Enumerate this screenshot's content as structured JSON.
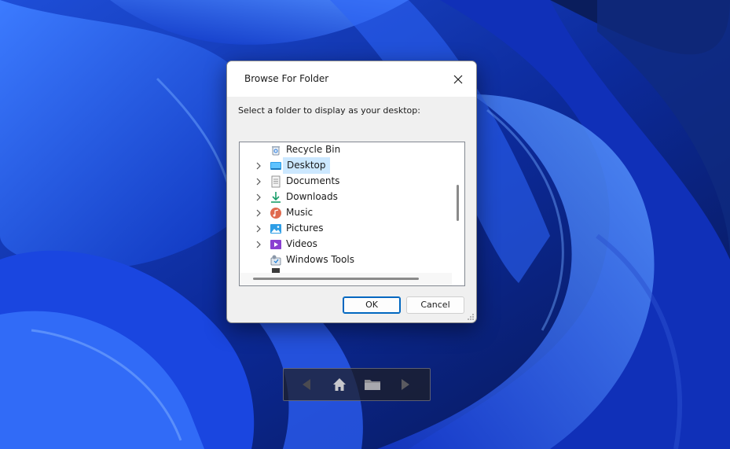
{
  "dialog": {
    "title": "Browse For Folder",
    "prompt": "Select a folder to display as your desktop:",
    "ok_label": "OK",
    "cancel_label": "Cancel"
  },
  "tree": {
    "items": [
      {
        "label": "Recycle Bin",
        "icon": "recycle-bin-icon",
        "expandable": false,
        "selected": false
      },
      {
        "label": "Desktop",
        "icon": "desktop-folder-icon",
        "expandable": true,
        "selected": true
      },
      {
        "label": "Documents",
        "icon": "documents-folder-icon",
        "expandable": true,
        "selected": false
      },
      {
        "label": "Downloads",
        "icon": "downloads-folder-icon",
        "expandable": true,
        "selected": false
      },
      {
        "label": "Music",
        "icon": "music-folder-icon",
        "expandable": true,
        "selected": false
      },
      {
        "label": "Pictures",
        "icon": "pictures-folder-icon",
        "expandable": true,
        "selected": false
      },
      {
        "label": "Videos",
        "icon": "videos-folder-icon",
        "expandable": true,
        "selected": false
      },
      {
        "label": "Windows Tools",
        "icon": "windows-tools-icon",
        "expandable": false,
        "selected": false
      }
    ]
  },
  "navbar": {
    "buttons": [
      "back-arrow-icon",
      "home-icon",
      "folder-icon",
      "forward-arrow-icon"
    ]
  },
  "colors": {
    "accent": "#0067c0",
    "selection": "#cce8ff",
    "wallpaper_dark": "#0a1a4a",
    "wallpaper_bright": "#2f6bff"
  }
}
